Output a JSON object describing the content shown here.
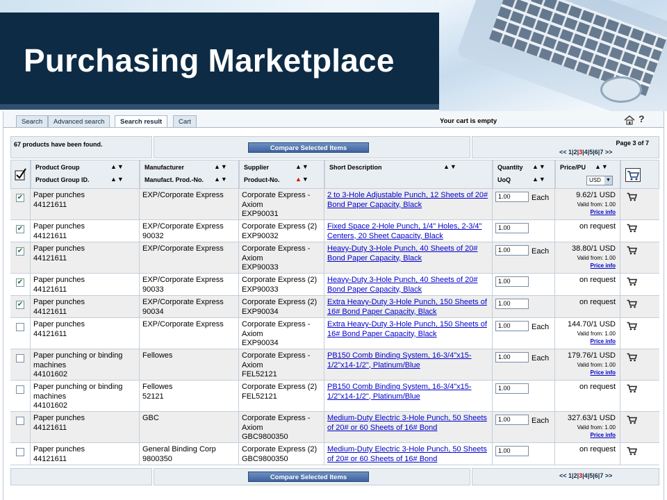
{
  "slide_title": "Purchasing Marketplace",
  "tabs": [
    "Search",
    "Advanced search",
    "Search result",
    "Cart"
  ],
  "active_tab": "Search result",
  "cart_status": "Your cart is empty",
  "help_label": "?",
  "results_found": "67 products have been found.",
  "compare_label": "Compare Selected Items",
  "page_label": "Page 3 of 7",
  "pager": {
    "prev": "<<",
    "pages": [
      "1",
      "2",
      "3",
      "4",
      "5",
      "6",
      "7"
    ],
    "current": "3",
    "next": ">>"
  },
  "headers": {
    "product_group": "Product Group",
    "product_group_id": "Product Group ID.",
    "manufacturer": "Manufacturer",
    "manufact_prod_no": "Manufact. Prod.-No.",
    "supplier": "Supplier",
    "product_no": "Product-No.",
    "short_description": "Short Description",
    "quantity": "Quantity",
    "uoq": "UoQ",
    "price_pu": "Price/PU",
    "currency": "USD"
  },
  "colors": {
    "banner_dark": "#0d2b45",
    "link": "#0000cc",
    "sort_active": "#dd0000"
  },
  "rows": [
    {
      "checked": true,
      "group": "Paper punches",
      "group_id": "44121611",
      "manufacturer": "EXP/Corporate Express",
      "manufacturer_no": "",
      "supplier": "Corporate Express - Axiom",
      "product_no": "EXP90031",
      "description": "2 to 3-Hole Adjustable Punch, 12 Sheets of 20# Bond Paper Capacity, Black",
      "qty": "1.00",
      "uom": "Each",
      "price": "9.62/1 USD",
      "valid": "Valid from: 1.00",
      "price_info": "Price info"
    },
    {
      "checked": true,
      "group": "Paper punches",
      "group_id": "44121611",
      "manufacturer": "EXP/Corporate Express",
      "manufacturer_no": "90032",
      "supplier": "Corporate Express (2)",
      "product_no": "EXP90032",
      "description": "Fixed Space 2-Hole Punch, 1/4\" Holes, 2-3/4\" Centers, 20 Sheet Capacity, Black",
      "qty": "1.00",
      "uom": "",
      "price": "on request",
      "valid": "",
      "price_info": ""
    },
    {
      "checked": true,
      "group": "Paper punches",
      "group_id": "44121611",
      "manufacturer": "EXP/Corporate Express",
      "manufacturer_no": "",
      "supplier": "Corporate Express - Axiom",
      "product_no": "EXP90033",
      "description": "Heavy-Duty 3-Hole Punch, 40 Sheets of 20# Bond Paper Capacity, Black",
      "qty": "1.00",
      "uom": "Each",
      "price": "38.80/1 USD",
      "valid": "Valid from: 1.00",
      "price_info": "Price info"
    },
    {
      "checked": true,
      "group": "Paper punches",
      "group_id": "44121611",
      "manufacturer": "EXP/Corporate Express",
      "manufacturer_no": "90033",
      "supplier": "Corporate Express (2)",
      "product_no": "EXP90033",
      "description": "Heavy-Duty 3-Hole Punch, 40 Sheets of 20# Bond Paper Capacity, Black",
      "qty": "1.00",
      "uom": "",
      "price": "on request",
      "valid": "",
      "price_info": ""
    },
    {
      "checked": true,
      "group": "Paper punches",
      "group_id": "44121611",
      "manufacturer": "EXP/Corporate Express",
      "manufacturer_no": "90034",
      "supplier": "Corporate Express (2)",
      "product_no": "EXP90034",
      "description": "Extra Heavy-Duty 3-Hole Punch, 150 Sheets of 16# Bond Paper Capacity, Black",
      "qty": "1.00",
      "uom": "",
      "price": "on request",
      "valid": "",
      "price_info": ""
    },
    {
      "checked": false,
      "group": "Paper punches",
      "group_id": "44121611",
      "manufacturer": "EXP/Corporate Express",
      "manufacturer_no": "",
      "supplier": "Corporate Express - Axiom",
      "product_no": "EXP90034",
      "description": "Extra Heavy-Duty 3-Hole Punch, 150 Sheets of 16# Bond Paper Capacity, Black",
      "qty": "1.00",
      "uom": "Each",
      "price": "144.70/1 USD",
      "valid": "Valid from: 1.00",
      "price_info": "Price info"
    },
    {
      "checked": false,
      "group": "Paper punching or binding machines",
      "group_id": "44101602",
      "manufacturer": "Fellowes",
      "manufacturer_no": "",
      "supplier": "Corporate Express - Axiom",
      "product_no": "FEL52121",
      "description": "PB150 Comb Binding System, 16-3/4\"x15-1/2\"x14-1/2\", Platinum/Blue",
      "qty": "1.00",
      "uom": "Each",
      "price": "179.76/1 USD",
      "valid": "Valid from: 1.00",
      "price_info": "Price info"
    },
    {
      "checked": false,
      "group": "Paper punching or binding machines",
      "group_id": "44101602",
      "manufacturer": "Fellowes",
      "manufacturer_no": "52121",
      "supplier": "Corporate Express (2)",
      "product_no": "FEL52121",
      "description": "PB150 Comb Binding System, 16-3/4\"x15-1/2\"x14-1/2\", Platinum/Blue",
      "qty": "1.00",
      "uom": "",
      "price": "on request",
      "valid": "",
      "price_info": ""
    },
    {
      "checked": false,
      "group": "Paper punches",
      "group_id": "44121611",
      "manufacturer": "GBC",
      "manufacturer_no": "",
      "supplier": "Corporate Express - Axiom",
      "product_no": "GBC9800350",
      "description": "Medium-Duty Electric 3-Hole Punch, 50 Sheets of 20# or 60 Sheets of 16# Bond",
      "qty": "1.00",
      "uom": "Each",
      "price": "327.63/1 USD",
      "valid": "Valid from: 1.00",
      "price_info": "Price info"
    },
    {
      "checked": false,
      "group": "Paper punches",
      "group_id": "44121611",
      "manufacturer": "General Binding Corp",
      "manufacturer_no": "9800350",
      "supplier": "Corporate Express (2)",
      "product_no": "GBC9800350",
      "description": "Medium-Duty Electric 3-Hole Punch, 50 Sheets of 20# or 60 Sheets of 16# Bond",
      "qty": "1.00",
      "uom": "",
      "price": "on request",
      "valid": "",
      "price_info": ""
    }
  ]
}
